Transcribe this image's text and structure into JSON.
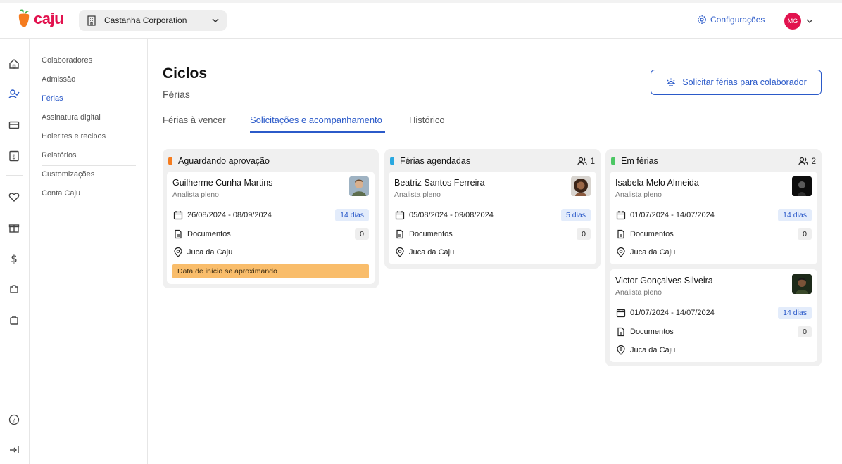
{
  "app": {
    "logo_text": "caju",
    "brand_color": "#e2134f",
    "accent_color": "#2b5ac9"
  },
  "header": {
    "company": "Castanha Corporation",
    "settings_label": "Configurações",
    "user_initials": "MG"
  },
  "rail": {
    "icons": [
      "home-icon",
      "user-check-icon",
      "card-icon",
      "dollar-doc-icon",
      "heart-icon",
      "gift-icon",
      "dollar-icon",
      "puzzle-icon",
      "bag-icon",
      "help-icon",
      "collapse-icon"
    ]
  },
  "subnav": {
    "items": [
      {
        "label": "Colaboradores"
      },
      {
        "label": "Admissão"
      },
      {
        "label": "Férias"
      },
      {
        "label": "Assinatura digital"
      },
      {
        "label": "Holerites e recibos"
      },
      {
        "label": "Relatórios"
      },
      {
        "label": "Customizações"
      },
      {
        "label": "Conta Caju"
      }
    ]
  },
  "page": {
    "title": "Ciclos",
    "subtitle": "Férias",
    "request_button": "Solicitar férias para colaborador",
    "tabs": [
      {
        "label": "Férias à vencer"
      },
      {
        "label": "Solicitações e acompanhamento"
      },
      {
        "label": "Histórico"
      }
    ]
  },
  "columns": [
    {
      "title": "Aguardando aprovação",
      "color": "#f57c1f",
      "count": "",
      "cards": [
        {
          "name": "Guilherme Cunha Martins",
          "role": "Analista pleno",
          "dates": "26/08/2024 - 08/09/2024",
          "days": "14 dias",
          "documents_label": "Documentos",
          "documents_count": "0",
          "manager": "Juca da Caju",
          "warning": "Data de início se aproximando"
        }
      ]
    },
    {
      "title": "Férias agendadas",
      "color": "#29a8e0",
      "count": "1",
      "cards": [
        {
          "name": "Beatriz Santos Ferreira",
          "role": "Analista pleno",
          "dates": "05/08/2024 - 09/08/2024",
          "days": "5 dias",
          "documents_label": "Documentos",
          "documents_count": "0",
          "manager": "Juca da Caju"
        }
      ]
    },
    {
      "title": "Em férias",
      "color": "#4cc764",
      "count": "2",
      "cards": [
        {
          "name": "Isabela Melo Almeida",
          "role": "Analista pleno",
          "dates": "01/07/2024 - 14/07/2024",
          "days": "14 dias",
          "documents_label": "Documentos",
          "documents_count": "0",
          "manager": "Juca da Caju"
        },
        {
          "name": "Victor Gonçalves Silveira",
          "role": "Analista pleno",
          "dates": "01/07/2024 - 14/07/2024",
          "days": "14 dias",
          "documents_label": "Documentos",
          "documents_count": "0",
          "manager": "Juca da Caju"
        }
      ]
    }
  ]
}
